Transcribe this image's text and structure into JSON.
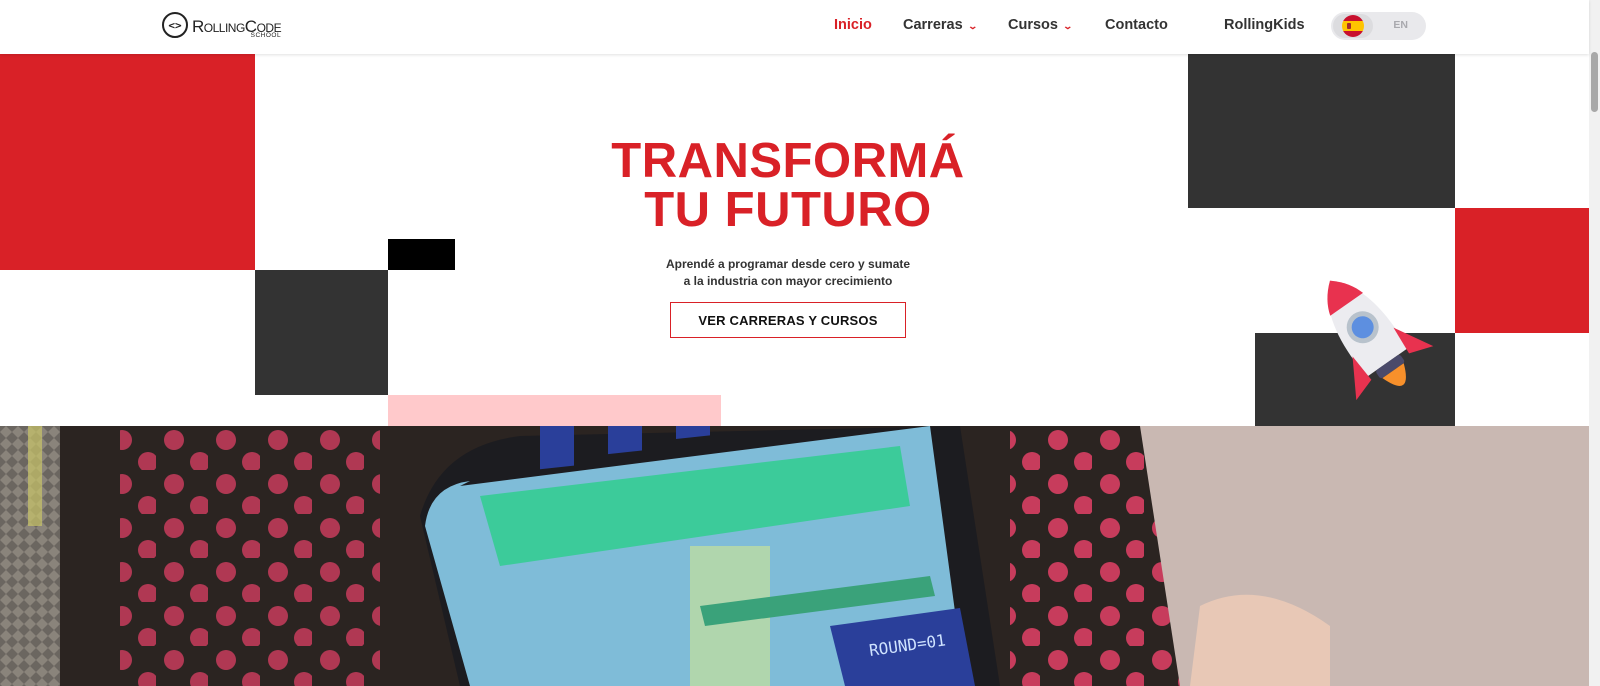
{
  "brand": {
    "logo_symbol": "<>",
    "logo_main": "RollingCode",
    "logo_sub": "SCHOOL"
  },
  "nav": {
    "items": [
      {
        "label": "Inicio",
        "active": true
      },
      {
        "label": "Carreras",
        "dropdown": true
      },
      {
        "label": "Cursos",
        "dropdown": true
      },
      {
        "label": "Contacto"
      },
      {
        "label": "RollingKids"
      }
    ],
    "dropdown_icon": "chevron-down-icon",
    "lang_toggle": {
      "selected": "ES",
      "flag_icon": "spain-flag-icon",
      "other_label": "EN"
    }
  },
  "hero": {
    "title_line1": "TRANSFORMÁ",
    "title_line2": "TU FUTURO",
    "subtitle_line1": "Aprendé a programar desde cero y sumate",
    "subtitle_line2": "a la industria con mayor crecimiento",
    "cta_label": "VER CARRERAS Y CURSOS",
    "decoration_icon": "rocket-icon"
  },
  "video": {
    "score_text": "ROUND=01"
  },
  "colors": {
    "accent": "#d92127",
    "dark_block": "#333333",
    "pink_block": "#ffc9cb",
    "text": "#333333"
  }
}
